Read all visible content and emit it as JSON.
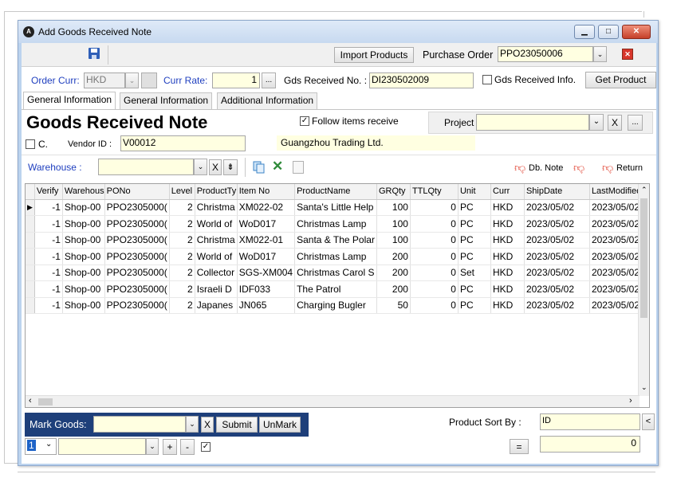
{
  "window": {
    "title": "Add Goods Received Note"
  },
  "toolbar": {
    "import_products": "Import Products",
    "purchase_order_label": "Purchase Order",
    "purchase_order_value": "PPO23050006"
  },
  "header": {
    "order_curr_label": "Order Curr:",
    "order_curr_value": "HKD",
    "curr_rate_label": "Curr Rate:",
    "curr_rate_value": "1",
    "gds_received_no_label": "Gds Received No. :",
    "gds_received_no_value": "DI230502009",
    "gds_received_info_label": "Gds Received Info.",
    "get_product_label": "Get Product"
  },
  "tabs": [
    "General Information",
    "General Information",
    "Additional Information"
  ],
  "form": {
    "heading": "Goods Received Note",
    "follow_items_label": "Follow items receive",
    "project_label": "Project",
    "c_label": "C.",
    "vendor_id_label": "Vendor ID :",
    "vendor_id_value": "V00012",
    "vendor_name": "Guangzhou Trading Ltd.",
    "warehouse_label": "Warehouse :",
    "db_note_label": "Db. Note",
    "return_label": "Return"
  },
  "grid": {
    "columns": [
      "Verify",
      "Warehous",
      "PONo",
      "Level",
      "ProductTy",
      "Item No",
      "ProductName",
      "GRQty",
      "TTLQty",
      "Unit",
      "Curr",
      "ShipDate",
      "LastModified"
    ],
    "rows": [
      [
        "-1",
        "Shop-00",
        "PPO2305000(",
        "2",
        "Christma",
        "XM022-02",
        "Santa's Little Help",
        "100",
        "0",
        "PC",
        "HKD",
        "2023/05/02",
        "2023/05/02"
      ],
      [
        "-1",
        "Shop-00",
        "PPO2305000(",
        "2",
        "World of",
        "WoD017",
        "Christmas Lamp",
        "100",
        "0",
        "PC",
        "HKD",
        "2023/05/02",
        "2023/05/02"
      ],
      [
        "-1",
        "Shop-00",
        "PPO2305000(",
        "2",
        "Christma",
        "XM022-01",
        "Santa & The Polar",
        "100",
        "0",
        "PC",
        "HKD",
        "2023/05/02",
        "2023/05/02"
      ],
      [
        "-1",
        "Shop-00",
        "PPO2305000(",
        "2",
        "World of",
        "WoD017",
        "Christmas Lamp",
        "200",
        "0",
        "PC",
        "HKD",
        "2023/05/02",
        "2023/05/02"
      ],
      [
        "-1",
        "Shop-00",
        "PPO2305000(",
        "2",
        "Collector",
        "SGS-XM004",
        "Christmas Carol S",
        "200",
        "0",
        "Set",
        "HKD",
        "2023/05/02",
        "2023/05/02"
      ],
      [
        "-1",
        "Shop-00",
        "PPO2305000(",
        "2",
        "Israeli D",
        "IDF033",
        "The Patrol",
        "200",
        "0",
        "PC",
        "HKD",
        "2023/05/02",
        "2023/05/02"
      ],
      [
        "-1",
        "Shop-00",
        "PPO2305000(",
        "2",
        "Japanes",
        "JN065",
        "Charging Bugler",
        "50",
        "0",
        "PC",
        "HKD",
        "2023/05/02",
        "2023/05/02"
      ]
    ]
  },
  "bottom": {
    "mark_goods_label": "Mark Goods:",
    "submit_label": "Submit",
    "unmark_label": "UnMark",
    "product_sort_by_label": "Product Sort By :",
    "product_sort_by_value": "ID",
    "page_value": "1",
    "equals_label": "=",
    "total_value": "0",
    "plus_label": "+",
    "minus_label": "-",
    "x_label": "X"
  }
}
